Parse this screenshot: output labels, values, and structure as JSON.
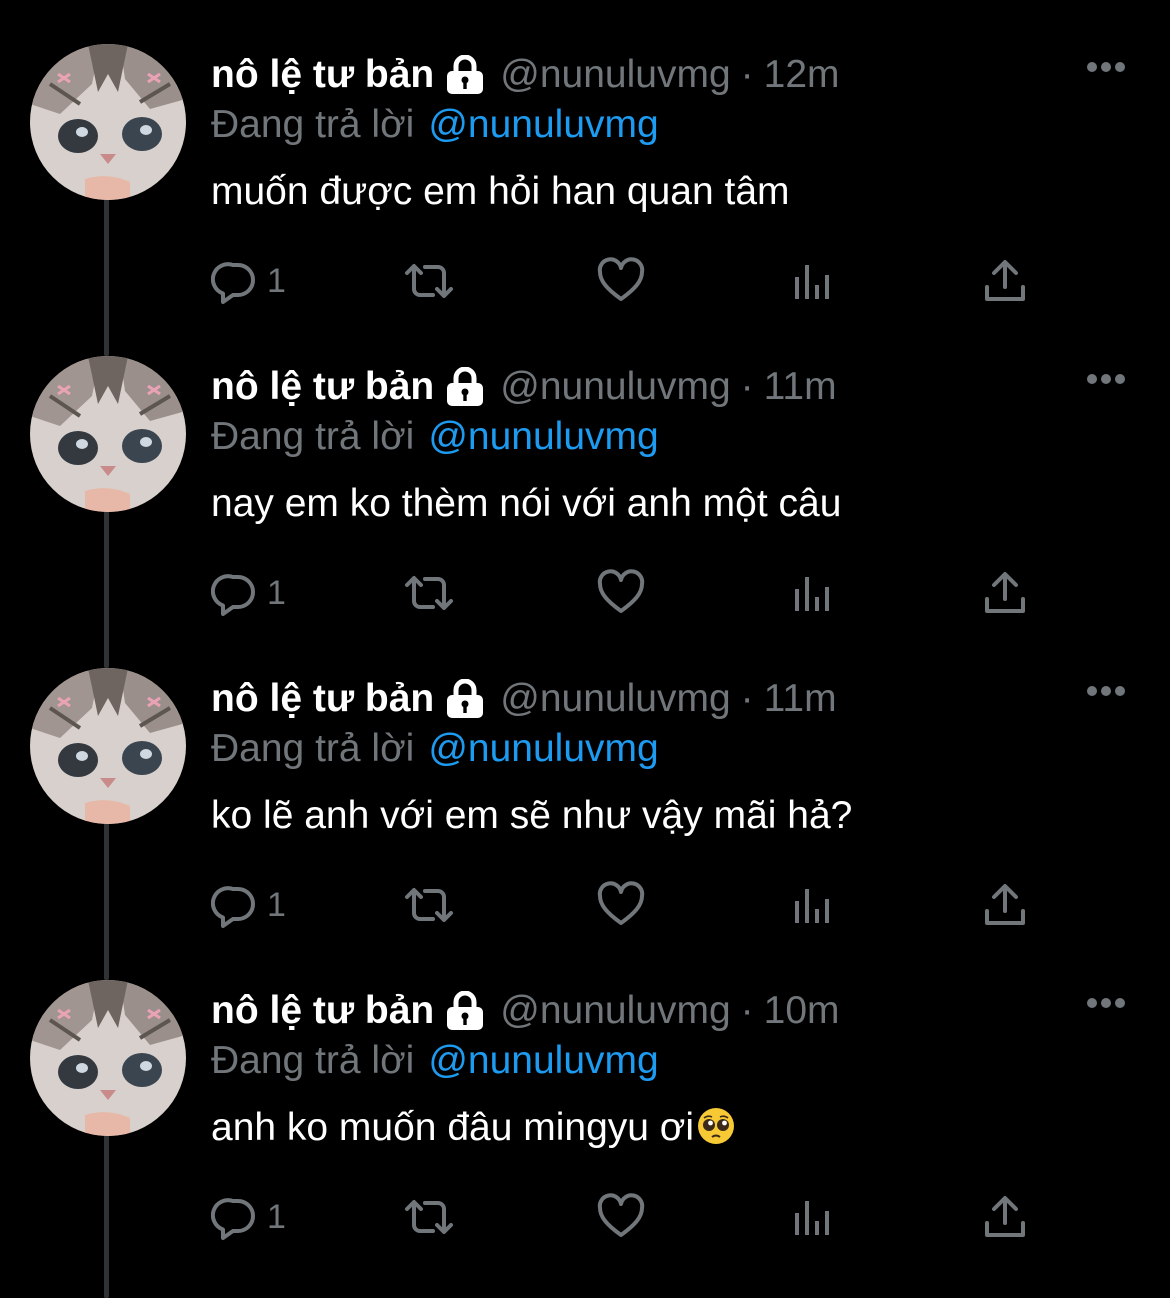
{
  "tweets": [
    {
      "name": "nô lệ tư bản",
      "handle": "@nunuluvmg",
      "separator": "·",
      "time": "12m",
      "reply_prefix": "Đang trả lời",
      "reply_to": "@nunuluvmg",
      "text": "muốn được em hỏi han quan tâm",
      "reply_count": "1"
    },
    {
      "name": "nô lệ tư bản",
      "handle": "@nunuluvmg",
      "separator": "·",
      "time": "11m",
      "reply_prefix": "Đang trả lời",
      "reply_to": "@nunuluvmg",
      "text": "nay em ko thèm nói với anh một câu",
      "reply_count": "1"
    },
    {
      "name": "nô lệ tư bản",
      "handle": "@nunuluvmg",
      "separator": "·",
      "time": "11m",
      "reply_prefix": "Đang trả lời",
      "reply_to": "@nunuluvmg",
      "text": "ko lẽ anh với em sẽ như vậy mãi hả?",
      "reply_count": "1"
    },
    {
      "name": "nô lệ tư bản",
      "handle": "@nunuluvmg",
      "separator": "·",
      "time": "10m",
      "reply_prefix": "Đang trả lời",
      "reply_to": "@nunuluvmg",
      "text": "anh ko muốn đâu mingyu ơi",
      "reply_count": "1"
    }
  ],
  "icons": {
    "lock": "lock-icon",
    "more": "more-icon",
    "reply": "reply-icon",
    "retweet": "retweet-icon",
    "like": "heart-icon",
    "views": "views-icon",
    "share": "share-icon",
    "emoji": "pleading-face-emoji"
  },
  "colors": {
    "background": "#000000",
    "text": "#e7e9ea",
    "muted": "#71767b",
    "link": "#1d9bf0",
    "thread_line": "#2f3336"
  }
}
